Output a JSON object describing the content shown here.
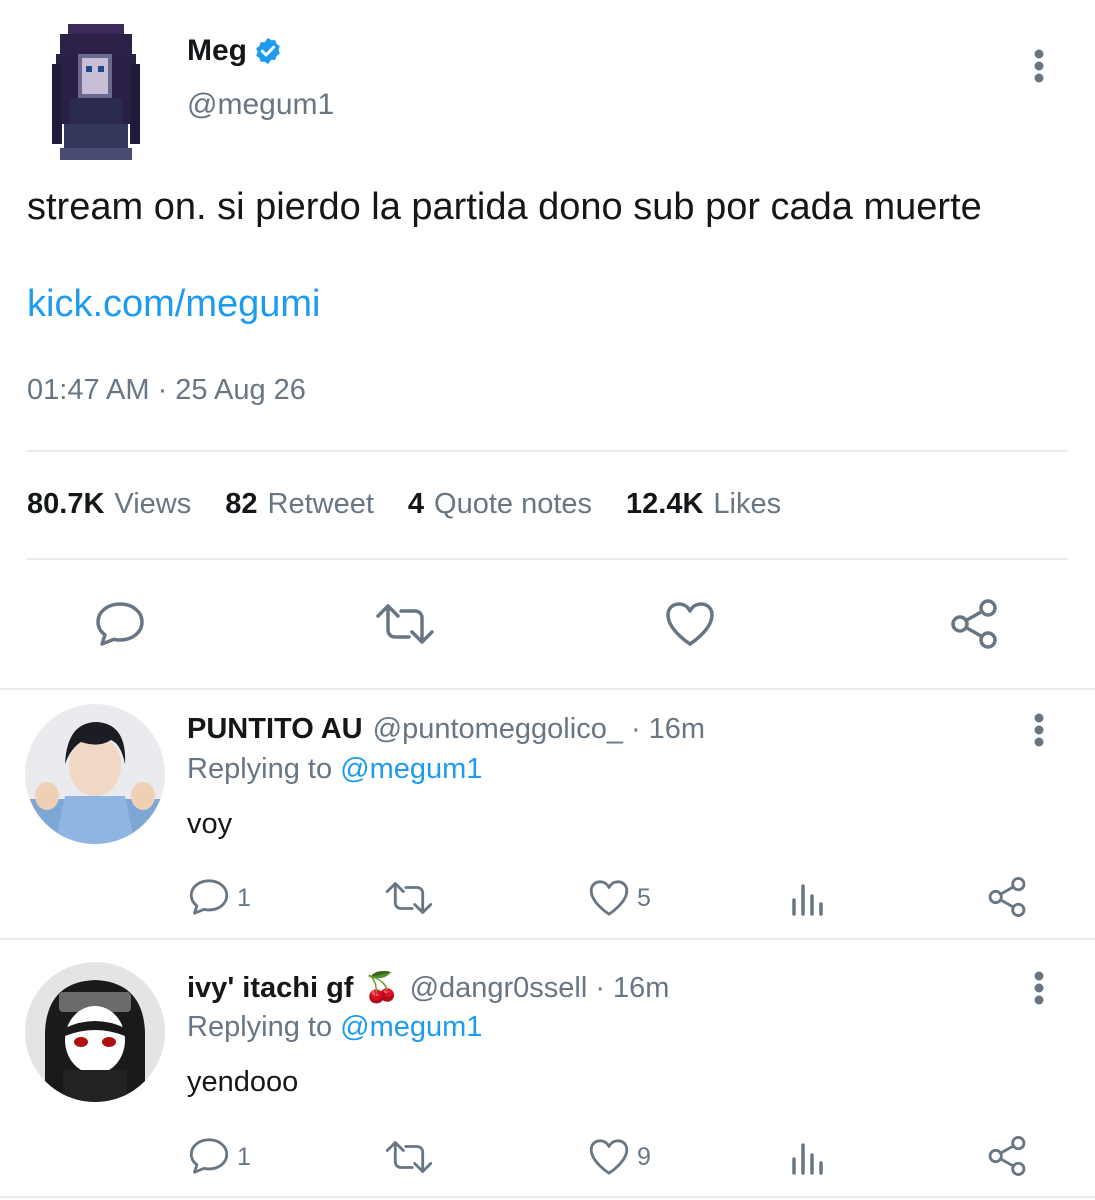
{
  "tweet": {
    "author_name": "Meg",
    "author_handle": "@megum1",
    "text": "stream on. si pierdo la partida dono sub por cada muerte",
    "link": "kick.com/megumi",
    "timestamp": "01:47 AM · 25 Aug 26",
    "stats": [
      {
        "value": "80.7K",
        "label": "Views"
      },
      {
        "value": "82",
        "label": "Retweet"
      },
      {
        "value": "4",
        "label": "Quote notes"
      },
      {
        "value": "12.4K",
        "label": "Likes"
      }
    ]
  },
  "replies": [
    {
      "name": "PUNTITO AU",
      "handle": "@puntomeggolico_",
      "time": "· 16m",
      "replying_prefix": "Replying to",
      "replying_to": "@megum1",
      "text": "voy",
      "reply_count": "1",
      "like_count": "5"
    },
    {
      "name": "ivy' itachi gf",
      "emoji": "🍒",
      "handle": "@dangr0ssell",
      "time": "· 16m",
      "replying_prefix": "Replying to",
      "replying_to": "@megum1",
      "text": "yendooo",
      "reply_count": "1",
      "like_count": "9"
    }
  ],
  "colors": {
    "accent": "#1d9bf0",
    "muted": "#687684",
    "divider": "#e6ecf0"
  }
}
